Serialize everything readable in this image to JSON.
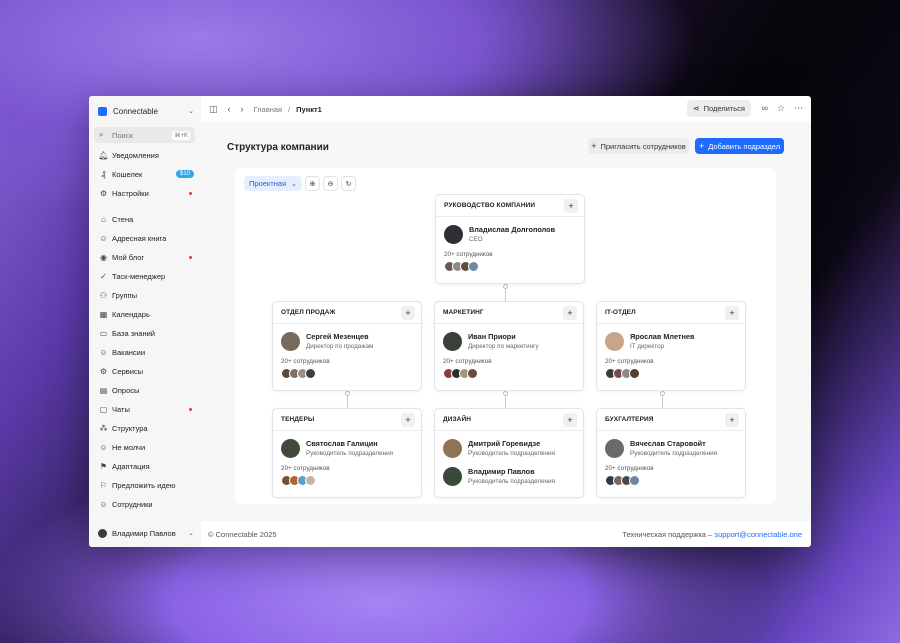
{
  "workspace": {
    "name": "Connectable"
  },
  "search": {
    "placeholder": "Поиск",
    "shortcut": "⌘+K"
  },
  "sidebar": {
    "top_items": [
      {
        "label": "Уведомления",
        "icon": "bell-icon"
      },
      {
        "label": "Кошелек",
        "icon": "wallet-icon",
        "badge": "$10"
      },
      {
        "label": "Настройки",
        "icon": "gear-icon",
        "dot": true
      }
    ],
    "items": [
      {
        "label": "Стена",
        "icon": "home-icon"
      },
      {
        "label": "Адресная книга",
        "icon": "contacts-icon"
      },
      {
        "label": "Мой блог",
        "icon": "blog-icon",
        "dot": true
      },
      {
        "label": "Таск-менеджер",
        "icon": "task-icon"
      },
      {
        "label": "Группы",
        "icon": "groups-icon"
      },
      {
        "label": "Календарь",
        "icon": "calendar-icon"
      },
      {
        "label": "База знаний",
        "icon": "folder-icon"
      },
      {
        "label": "Вакансии",
        "icon": "vacancy-icon"
      },
      {
        "label": "Сервисы",
        "icon": "services-icon"
      },
      {
        "label": "Опросы",
        "icon": "poll-icon"
      },
      {
        "label": "Чаты",
        "icon": "chat-icon",
        "dot": true
      },
      {
        "label": "Структура",
        "icon": "structure-icon"
      },
      {
        "label": "Не молчи",
        "icon": "smile-icon"
      },
      {
        "label": "Адаптация",
        "icon": "flag-icon"
      },
      {
        "label": "Предложить идею",
        "icon": "idea-icon"
      },
      {
        "label": "Сотрудники",
        "icon": "add-user-icon"
      }
    ],
    "user": "Владимир Павлов"
  },
  "topbar": {
    "breadcrumb_home": "Главная",
    "breadcrumb_current": "Пункт1",
    "share_label": "Поделиться"
  },
  "page": {
    "title": "Структура компании",
    "invite_label": "Пригласить сотрудников",
    "add_label": "Добавить подраздел",
    "view_select": "Проектная"
  },
  "org": {
    "top": {
      "title": "РУКОВОДСТВО КОМПАНИИ",
      "name": "Владислав Долгополов",
      "role": "CEO",
      "count": "20+ сотрудников"
    },
    "level2": [
      {
        "title": "ОТДЕЛ ПРОДАЖ",
        "name": "Сергей Мезенцев",
        "role": "Директор по продажам",
        "count": "20+ сотрудников"
      },
      {
        "title": "МАРКЕТИНГ",
        "name": "Иван Приори",
        "role": "Директор по маркетингу",
        "count": "20+ сотрудников"
      },
      {
        "title": "IT-ОТДЕЛ",
        "name": "Ярослав Млетнев",
        "role": "IT директор",
        "count": "20+ сотрудников"
      }
    ],
    "level3": [
      {
        "title": "ТЕНДЕРЫ",
        "name": "Святослав Галицин",
        "role": "Руководитель подразделения",
        "count": "20+ сотрудников"
      },
      {
        "title": "ДИЗАЙН",
        "name": "Дмитрий Горевидзе",
        "role": "Руководитель подразделения",
        "name2": "Владимир Павлов",
        "role2": "Руководитель подразделения"
      },
      {
        "title": "БУХГАЛТЕРИЯ",
        "name": "Вячеслав Старовойт",
        "role": "Руководитель подразделения",
        "count": "20+ сотрудников"
      }
    ]
  },
  "footer": {
    "copyright": "© Connectable 2025",
    "support_label": "Техническая поддержка –",
    "support_email": "support@connectable.one"
  },
  "colors": {
    "accent": "#1f6bff",
    "badge": "#2ea7ee",
    "dot": "#e23a3a"
  }
}
